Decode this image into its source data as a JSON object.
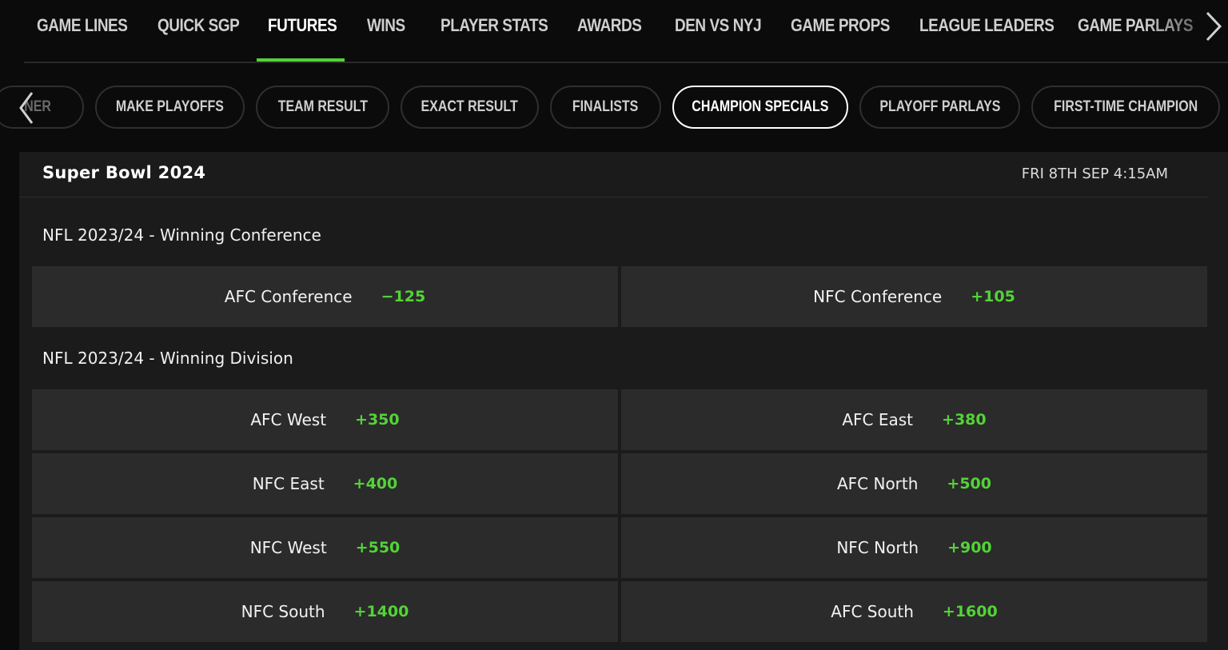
{
  "top_tabs": [
    "GAME LINES",
    "QUICK SGP",
    "FUTURES",
    "WINS",
    "PLAYER STATS",
    "AWARDS",
    "DEN VS NYJ",
    "GAME PROPS",
    "LEAGUE LEADERS",
    "GAME PARLAYS"
  ],
  "active_top_tab": "FUTURES",
  "sub_tabs": [
    "NER",
    "MAKE PLAYOFFS",
    "TEAM RESULT",
    "EXACT RESULT",
    "FINALISTS",
    "CHAMPION SPECIALS",
    "PLAYOFF PARLAYS",
    "FIRST-TIME CHAMPION"
  ],
  "active_sub_tab": "CHAMPION SPECIALS",
  "event": {
    "title": "Super Bowl 2024",
    "time": "FRI 8TH SEP 4:15AM"
  },
  "markets": [
    {
      "title": "NFL 2023/24 - Winning Conference",
      "selections": [
        {
          "name": "AFC Conference",
          "odds": "−125"
        },
        {
          "name": "NFC Conference",
          "odds": "+105"
        }
      ]
    },
    {
      "title": "NFL 2023/24 - Winning Division",
      "selections": [
        {
          "name": "AFC West",
          "odds": "+350"
        },
        {
          "name": "AFC East",
          "odds": "+380"
        },
        {
          "name": "NFC East",
          "odds": "+400"
        },
        {
          "name": "AFC North",
          "odds": "+500"
        },
        {
          "name": "NFC West",
          "odds": "+550"
        },
        {
          "name": "NFC North",
          "odds": "+900"
        },
        {
          "name": "NFC South",
          "odds": "+1400"
        },
        {
          "name": "AFC South",
          "odds": "+1600"
        }
      ]
    }
  ],
  "icons": {
    "left": "chevron-left-icon",
    "right": "chevron-right-icon"
  },
  "colors": {
    "accent": "#53d337",
    "background": "#0b0b0b",
    "panel": "#1b1b1b",
    "cell": "#2b2b2b"
  }
}
